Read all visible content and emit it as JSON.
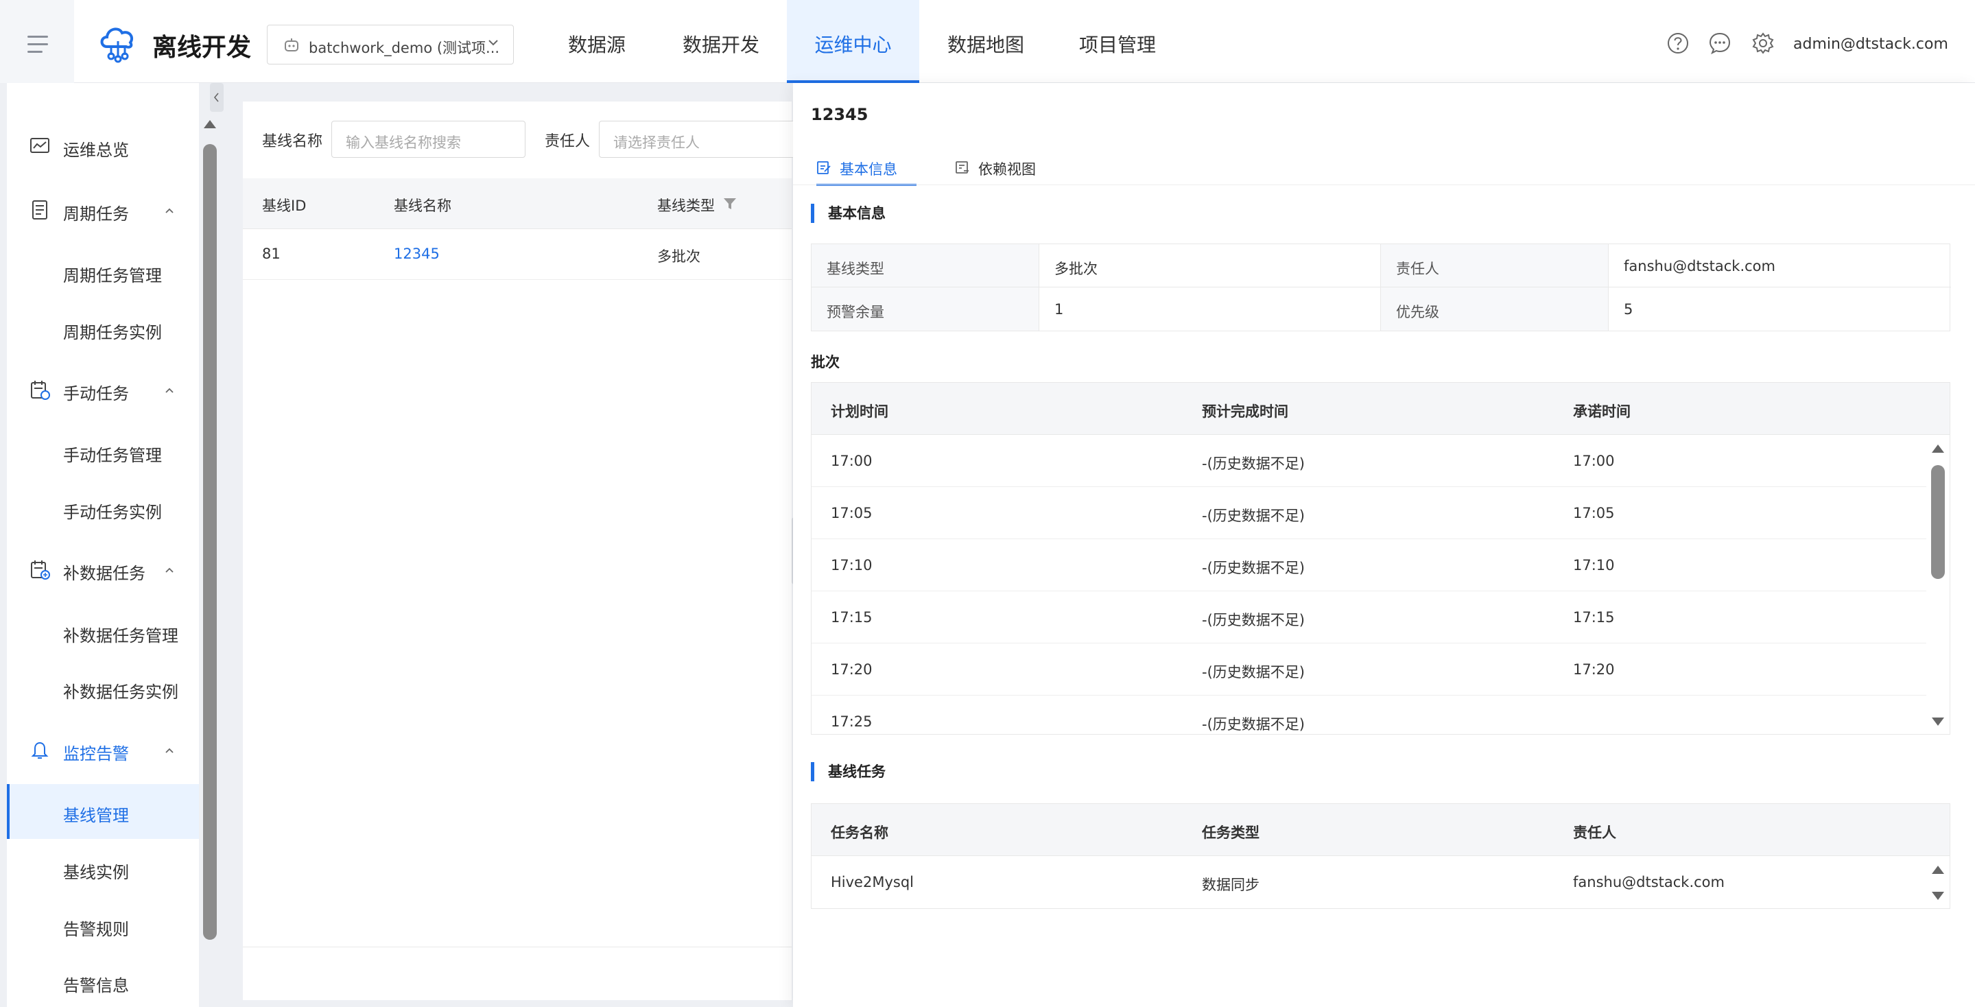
{
  "header": {
    "app_title": "离线开发",
    "project": "batchwork_demo (测试项...",
    "nav": [
      "数据源",
      "数据开发",
      "运维中心",
      "数据地图",
      "项目管理"
    ],
    "active_nav": "运维中心",
    "user": "admin@dtstack.com",
    "accent": "#1f6fe5"
  },
  "sidebar": {
    "overview": "运维总览",
    "groups": [
      {
        "label": "周期任务",
        "items": [
          "周期任务管理",
          "周期任务实例"
        ]
      },
      {
        "label": "手动任务",
        "items": [
          "手动任务管理",
          "手动任务实例"
        ]
      },
      {
        "label": "补数据任务",
        "items": [
          "补数据任务管理",
          "补数据任务实例"
        ]
      },
      {
        "label": "监控告警",
        "items": [
          "基线管理",
          "基线实例",
          "告警规则",
          "告警信息"
        ]
      }
    ],
    "active_item": "基线管理"
  },
  "filters": {
    "name_label": "基线名称",
    "name_placeholder": "输入基线名称搜索",
    "owner_label": "责任人",
    "owner_placeholder": "请选择责任人"
  },
  "list": {
    "columns": [
      "基线ID",
      "基线名称",
      "基线类型"
    ],
    "rows": [
      {
        "id": "81",
        "name": "12345",
        "type": "多批次"
      }
    ]
  },
  "drawer": {
    "title": "12345",
    "tabs": [
      "基本信息",
      "依赖视图"
    ],
    "basic_section": "基本信息",
    "basic": [
      {
        "k1": "基线类型",
        "v1": "多批次",
        "k2": "责任人",
        "v2": "fanshu@dtstack.com"
      },
      {
        "k1": "预警余量",
        "v1": "1",
        "k2": "优先级",
        "v2": "5"
      }
    ],
    "batch_section": "批次",
    "batch_columns": [
      "计划时间",
      "预计完成时间",
      "承诺时间"
    ],
    "batch_rows": [
      {
        "plan": "17:00",
        "est": "-(历史数据不足)",
        "promise": "17:00"
      },
      {
        "plan": "17:05",
        "est": "-(历史数据不足)",
        "promise": "17:05"
      },
      {
        "plan": "17:10",
        "est": "-(历史数据不足)",
        "promise": "17:10"
      },
      {
        "plan": "17:15",
        "est": "-(历史数据不足)",
        "promise": "17:15"
      },
      {
        "plan": "17:20",
        "est": "-(历史数据不足)",
        "promise": "17:20"
      },
      {
        "plan": "17:25",
        "est": "-(历史数据不足)",
        "promise": ""
      }
    ],
    "task_section": "基线任务",
    "task_columns": [
      "任务名称",
      "任务类型",
      "责任人"
    ],
    "task_rows": [
      {
        "name": "Hive2Mysql",
        "type": "数据同步",
        "owner": "fanshu@dtstack.com"
      }
    ]
  }
}
